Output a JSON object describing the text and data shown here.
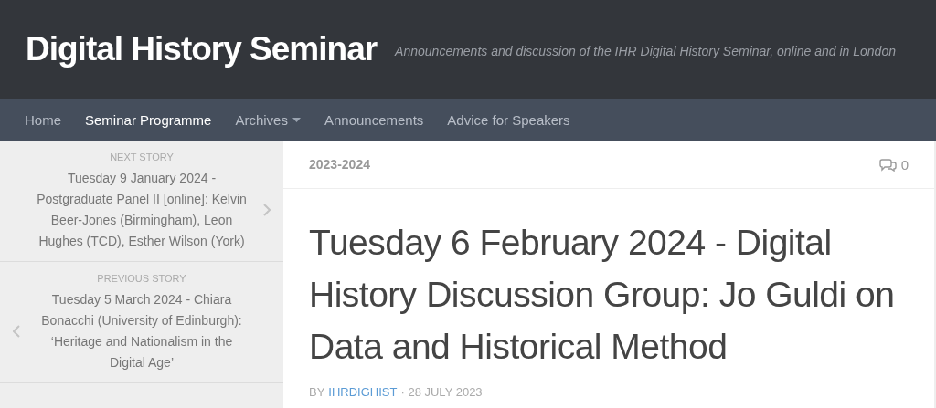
{
  "site": {
    "title": "Digital History Seminar",
    "tagline": "Announcements and discussion of the IHR Digital History Seminar, online and in London"
  },
  "nav": [
    {
      "label": "Home",
      "selected": false,
      "dropdown": false
    },
    {
      "label": "Seminar Programme",
      "selected": true,
      "dropdown": false
    },
    {
      "label": "Archives",
      "selected": false,
      "dropdown": true
    },
    {
      "label": "Announcements",
      "selected": false,
      "dropdown": false
    },
    {
      "label": "Advice for Speakers",
      "selected": false,
      "dropdown": false
    }
  ],
  "sidebar": [
    {
      "kind": "next",
      "label": "NEXT STORY",
      "title": "Tuesday 9 January 2024  -  Postgraduate Panel II [online]: Kelvin Beer-Jones (Birmingham), Leon Hughes (TCD), Esther Wilson (York)"
    },
    {
      "kind": "previous",
      "label": "PREVIOUS STORY",
      "title": "Tuesday 5 March 2024  -  Chiara Bonacchi (University of Edinburgh): ‘Heritage and Nationalism in the Digital Age’"
    }
  ],
  "post": {
    "category": "2023-2024",
    "comments": "0",
    "title": "Tuesday 6 February 2024  -  Digital History Discussion Group: Jo Guldi on Data and Historical Method",
    "by": "BY",
    "author": "IHRDIGHIST",
    "date": "· 28 JULY 2023"
  }
}
